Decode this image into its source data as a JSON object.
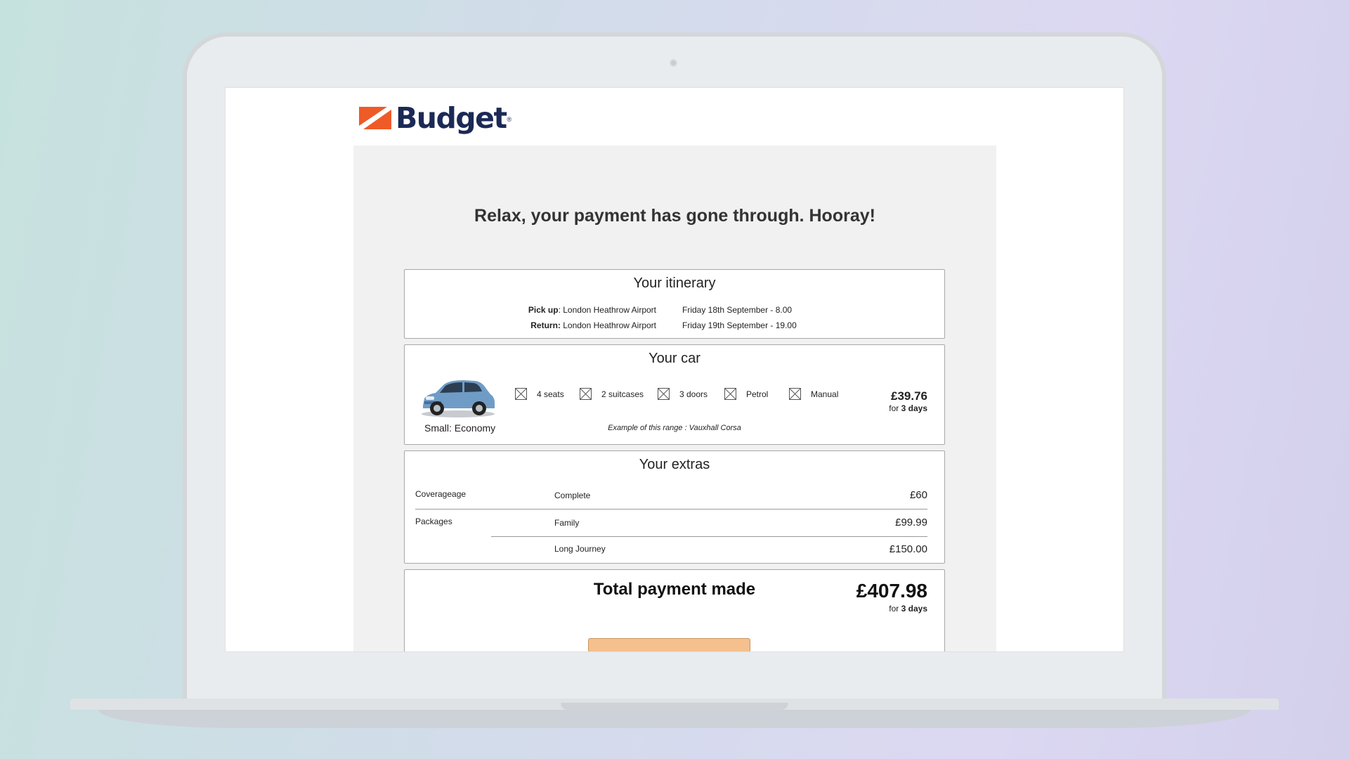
{
  "brand": {
    "name": "Budget",
    "registered": "®",
    "colors": {
      "orange": "#ee5b26",
      "navy": "#1b2a55"
    }
  },
  "headline": "Relax, your payment has gone through. Hooray!",
  "itinerary": {
    "title": "Your itinerary",
    "pickup": {
      "label": "Pick up",
      "location": ": London Heathrow Airport",
      "datetime": "Friday 18th September - 8.00"
    },
    "return": {
      "label": "Return:",
      "location": " London Heathrow Airport",
      "datetime": "Friday 19th September - 19.00"
    }
  },
  "car": {
    "title": "Your car",
    "class": "Small: Economy",
    "features": [
      {
        "icon": "broken-image-icon",
        "label": "4 seats"
      },
      {
        "icon": "broken-image-icon",
        "label": "2 suitcases"
      },
      {
        "icon": "broken-image-icon",
        "label": "3 doors"
      },
      {
        "icon": "broken-image-icon",
        "label": "Petrol"
      },
      {
        "icon": "broken-image-icon",
        "label": "Manual"
      }
    ],
    "example": "Example of this range : Vauxhall Corsa",
    "price": "£39.76",
    "duration_prefix": "for",
    "duration": "3 days"
  },
  "extras": {
    "title": "Your extras",
    "coverage": {
      "label": "Coverageage",
      "name": "Complete",
      "price": "£60"
    },
    "packages": {
      "label": "Packages",
      "items": [
        {
          "name": "Family",
          "price": "£99.99"
        },
        {
          "name": "Long Journey",
          "price": "£150.00"
        }
      ]
    }
  },
  "total": {
    "title": "Total payment made",
    "price": "£407.98",
    "duration_prefix": "for",
    "duration": "3 days",
    "button_color": "#f6c08e"
  }
}
